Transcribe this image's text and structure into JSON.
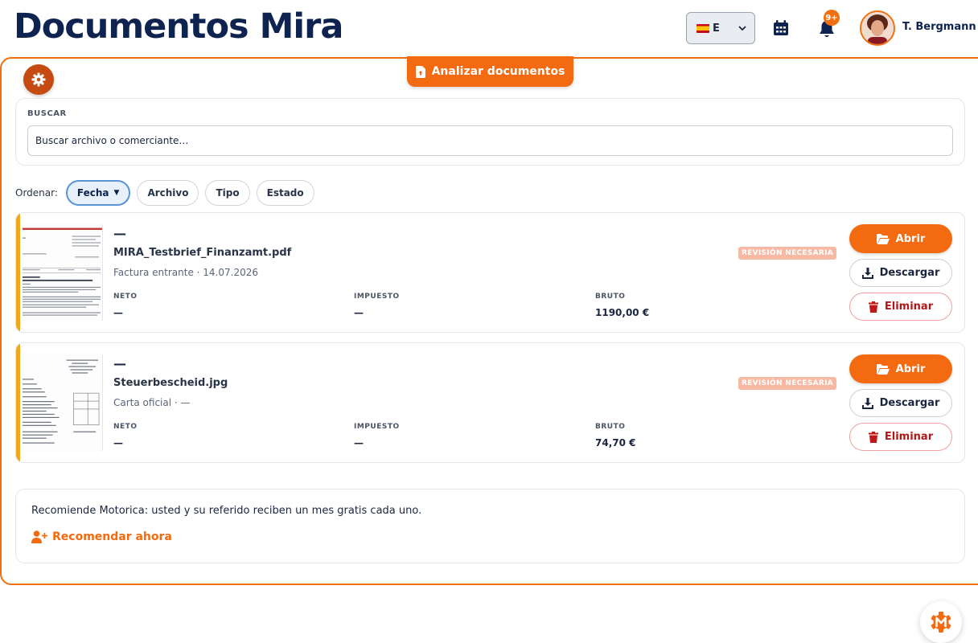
{
  "header": {
    "app_title": "Documentos Mira",
    "language": "E",
    "notifications_badge": "9+",
    "user_name": "T. Bergmann"
  },
  "toolbar": {
    "analyze_label": "Analizar documentos"
  },
  "search": {
    "label": "BUSCAR",
    "placeholder": "Buscar archivo o comerciante…"
  },
  "sort": {
    "label": "Ordenar:",
    "options": [
      {
        "label": "Fecha",
        "active": true,
        "indicator": "▼"
      },
      {
        "label": "Archivo",
        "active": false
      },
      {
        "label": "Tipo",
        "active": false
      },
      {
        "label": "Estado",
        "active": false
      }
    ]
  },
  "documents": [
    {
      "title": "—",
      "filename": "MIRA_Testbrief_Finanzamt.pdf",
      "meta": "Factura entrante · 14.07.2026",
      "status": "REVISIÓN NECESARIA",
      "net_label": "NETO",
      "net_value": "—",
      "tax_label": "IMPUESTO",
      "tax_value": "—",
      "gross_label": "BRUTO",
      "gross_value": "1190,00 €",
      "open_label": "Abrir",
      "download_label": "Descargar",
      "delete_label": "Eliminar"
    },
    {
      "title": "—",
      "filename": "Steuerbescheid.jpg",
      "meta": "Carta oficial · —",
      "status": "REVISIÓN NECESARIA",
      "net_label": "NETO",
      "net_value": "—",
      "tax_label": "IMPUESTO",
      "tax_value": "—",
      "gross_label": "BRUTO",
      "gross_value": "74,70 €",
      "open_label": "Abrir",
      "download_label": "Descargar",
      "delete_label": "Eliminar"
    }
  ],
  "referral": {
    "text": "Recomiende Motorica: usted y su referido reciben un mes gratis cada uno.",
    "link_label": "Recomendar ahora"
  },
  "colors": {
    "accent": "#f36a10",
    "title": "#0f2350",
    "danger": "#b01818",
    "badge": "#f7b9a4",
    "stripe": "#f0a818"
  }
}
